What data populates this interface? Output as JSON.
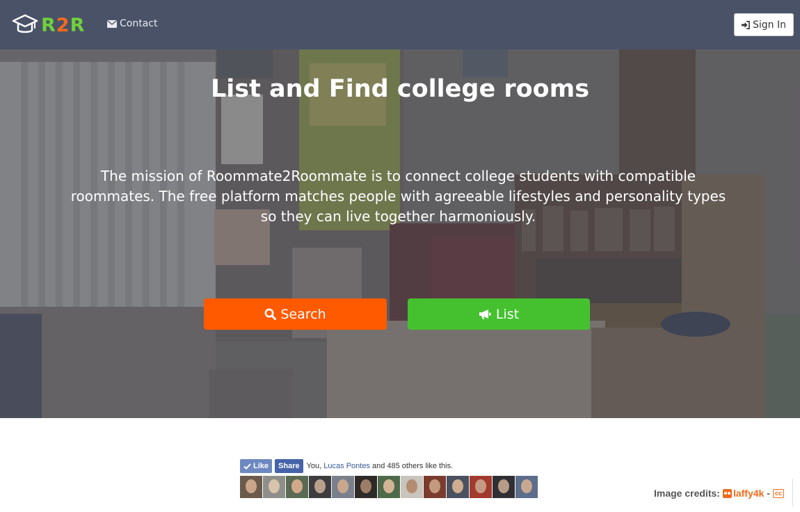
{
  "navbar": {
    "logo": {
      "text_r": "R",
      "text_2": "2",
      "text_r2": "R",
      "icon": "graduation-cap-icon"
    },
    "contact": {
      "icon": "envelope-icon",
      "label": "Contact"
    },
    "signin": {
      "icon": "sign-in-icon",
      "label": "Sign In"
    }
  },
  "hero": {
    "title": {
      "bold1": "List",
      "mid": " and ",
      "bold2": "Find",
      "rest": " college rooms"
    },
    "mission": "The mission of Roommate2Roommate is to connect college students with compatible roommates. The free platform matches people with agreeable lifestyles and personality types so they can live together harmoniously.",
    "buttons": [
      {
        "icon": "search-icon",
        "label": "Search",
        "color": "#ff5a00"
      },
      {
        "icon": "bullhorn-icon",
        "label": "List",
        "color": "#45c12f"
      }
    ]
  },
  "facebook": {
    "like_label": "Like",
    "share_label": "Share",
    "text_prefix": "You, ",
    "friend_name": "Lucas Pontes",
    "text_suffix": " and 485 others like this.",
    "faces_count": 13
  },
  "credits": {
    "label": "Image credits:",
    "author": "laffy4k",
    "separator": "-",
    "license": "cc"
  },
  "colors": {
    "navbar": "#4a5268",
    "search": "#ff5a00",
    "list": "#45c12f",
    "accent_orange": "#f36b1c",
    "accent_green": "#6fd13a"
  }
}
